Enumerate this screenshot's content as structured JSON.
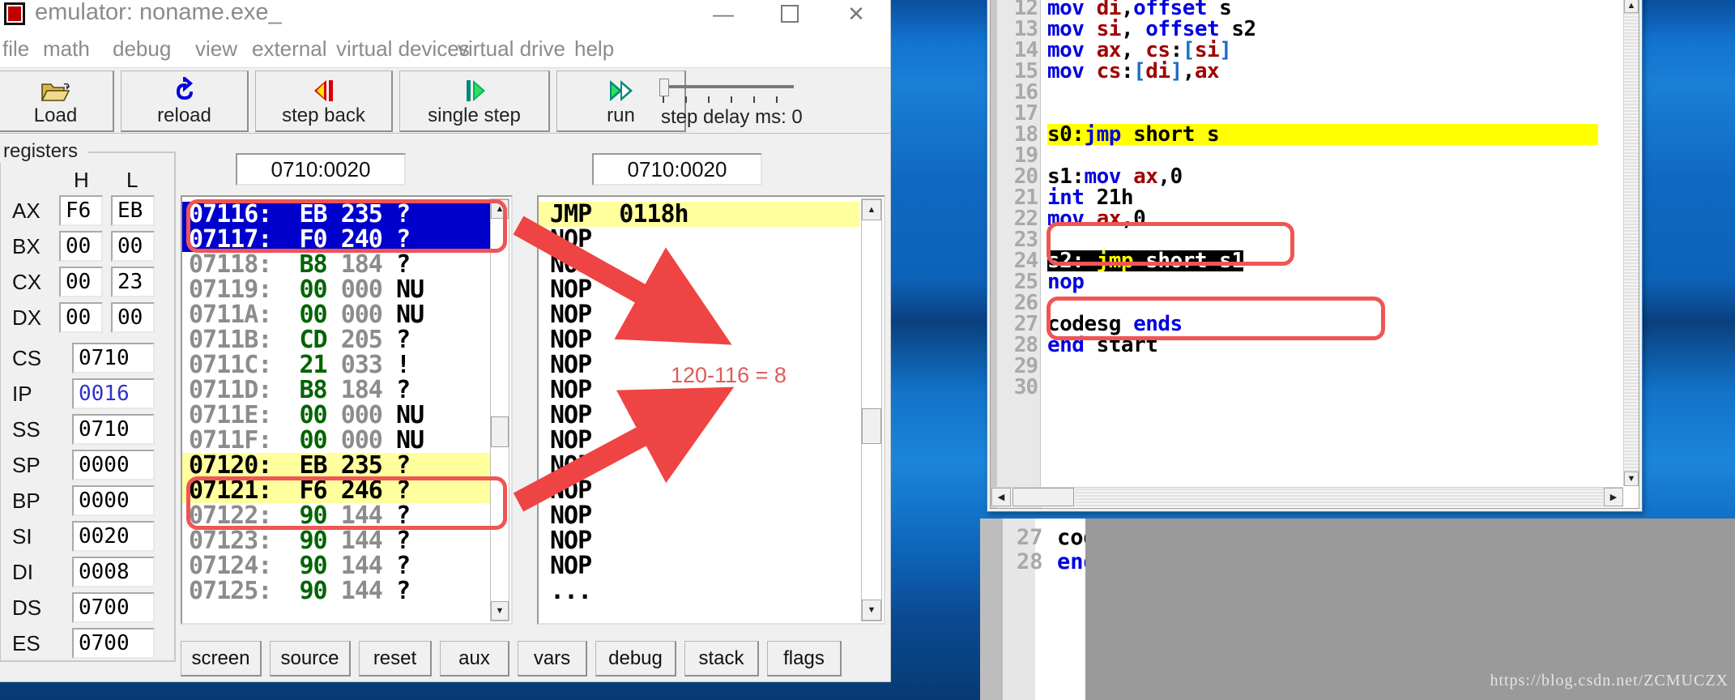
{
  "window": {
    "title": "emulator: noname.exe_",
    "icon": "chip-icon",
    "controls": {
      "minimize": "—",
      "maximize": "☐",
      "close": "✕"
    }
  },
  "menu": {
    "items": [
      "file",
      "math",
      "debug",
      "view",
      "external",
      "virtual devices",
      "virtual drive",
      "help"
    ]
  },
  "toolbar": {
    "buttons": [
      {
        "label": "Load",
        "icon": "open-folder-icon"
      },
      {
        "label": "reload",
        "icon": "reload-arrow-icon"
      },
      {
        "label": "step back",
        "icon": "step-back-icon"
      },
      {
        "label": "single step",
        "icon": "single-step-icon"
      },
      {
        "label": "run",
        "icon": "run-icon"
      }
    ],
    "delay_label": "step delay ms: 0",
    "delay_value": 0
  },
  "registers": {
    "legend": "registers",
    "col_headers": [
      "H",
      "L"
    ],
    "pairs": [
      {
        "name": "AX",
        "h": "F6",
        "l": "EB"
      },
      {
        "name": "BX",
        "h": "00",
        "l": "00"
      },
      {
        "name": "CX",
        "h": "00",
        "l": "23"
      },
      {
        "name": "DX",
        "h": "00",
        "l": "00"
      }
    ],
    "singles": [
      {
        "name": "CS",
        "value": "0710",
        "highlight": false
      },
      {
        "name": "IP",
        "value": "0016",
        "highlight": true
      },
      {
        "name": "SS",
        "value": "0710",
        "highlight": false
      },
      {
        "name": "SP",
        "value": "0000",
        "highlight": false
      },
      {
        "name": "BP",
        "value": "0000",
        "highlight": false
      },
      {
        "name": "SI",
        "value": "0020",
        "highlight": false
      },
      {
        "name": "DI",
        "value": "0008",
        "highlight": false
      },
      {
        "name": "DS",
        "value": "0700",
        "highlight": false
      },
      {
        "name": "ES",
        "value": "0700",
        "highlight": false
      }
    ]
  },
  "memory": {
    "address_field": "0710:0020",
    "rows": [
      {
        "addr": "07116:",
        "hex": "EB",
        "dec": "235",
        "chr": "?",
        "state": "selected"
      },
      {
        "addr": "07117:",
        "hex": "F0",
        "dec": "240",
        "chr": "?",
        "state": "selected"
      },
      {
        "addr": "07118:",
        "hex": "B8",
        "dec": "184",
        "chr": "?",
        "state": "normal"
      },
      {
        "addr": "07119:",
        "hex": "00",
        "dec": "000",
        "chr": "NU",
        "state": "normal"
      },
      {
        "addr": "0711A:",
        "hex": "00",
        "dec": "000",
        "chr": "NU",
        "state": "normal"
      },
      {
        "addr": "0711B:",
        "hex": "CD",
        "dec": "205",
        "chr": "?",
        "state": "normal"
      },
      {
        "addr": "0711C:",
        "hex": "21",
        "dec": "033",
        "chr": "!",
        "state": "normal"
      },
      {
        "addr": "0711D:",
        "hex": "B8",
        "dec": "184",
        "chr": "?",
        "state": "normal"
      },
      {
        "addr": "0711E:",
        "hex": "00",
        "dec": "000",
        "chr": "NU",
        "state": "normal"
      },
      {
        "addr": "0711F:",
        "hex": "00",
        "dec": "000",
        "chr": "NU",
        "state": "normal"
      },
      {
        "addr": "07120:",
        "hex": "EB",
        "dec": "235",
        "chr": "?",
        "state": "marked"
      },
      {
        "addr": "07121:",
        "hex": "F6",
        "dec": "246",
        "chr": "?",
        "state": "marked"
      },
      {
        "addr": "07122:",
        "hex": "90",
        "dec": "144",
        "chr": "?",
        "state": "normal"
      },
      {
        "addr": "07123:",
        "hex": "90",
        "dec": "144",
        "chr": "?",
        "state": "normal"
      },
      {
        "addr": "07124:",
        "hex": "90",
        "dec": "144",
        "chr": "?",
        "state": "normal"
      },
      {
        "addr": "07125:",
        "hex": "90",
        "dec": "144",
        "chr": "?",
        "state": "normal"
      }
    ]
  },
  "disassembly": {
    "address_field": "0710:0020",
    "rows": [
      {
        "text": "JMP  0118h",
        "highlight": true
      },
      {
        "text": "NOP",
        "highlight": false
      },
      {
        "text": "NOP",
        "highlight": false
      },
      {
        "text": "NOP",
        "highlight": false
      },
      {
        "text": "NOP",
        "highlight": false
      },
      {
        "text": "NOP",
        "highlight": false
      },
      {
        "text": "NOP",
        "highlight": false
      },
      {
        "text": "NOP",
        "highlight": false
      },
      {
        "text": "NOP",
        "highlight": false
      },
      {
        "text": "NOP",
        "highlight": false
      },
      {
        "text": "NOP",
        "highlight": false
      },
      {
        "text": "NOP",
        "highlight": false
      },
      {
        "text": "NOP",
        "highlight": false
      },
      {
        "text": "NOP",
        "highlight": false
      },
      {
        "text": "NOP",
        "highlight": false
      },
      {
        "text": "...",
        "highlight": false
      }
    ]
  },
  "bottom_buttons": [
    "screen",
    "source",
    "reset",
    "aux",
    "vars",
    "debug",
    "stack",
    "flags"
  ],
  "annotations": {
    "difference_note": "120-116 = 8"
  },
  "source_editor": {
    "lines": [
      {
        "num": "12",
        "tokens": [
          {
            "t": "mov ",
            "c": "kw"
          },
          {
            "t": "di",
            "c": "reg"
          },
          {
            "t": ",",
            "c": "plain"
          },
          {
            "t": "offset ",
            "c": "kw"
          },
          {
            "t": "s",
            "c": "plain"
          }
        ],
        "style": "none"
      },
      {
        "num": "13",
        "tokens": [
          {
            "t": "mov ",
            "c": "kw"
          },
          {
            "t": "si",
            "c": "reg"
          },
          {
            "t": ", ",
            "c": "plain"
          },
          {
            "t": "offset ",
            "c": "kw"
          },
          {
            "t": "s2",
            "c": "plain"
          }
        ],
        "style": "none"
      },
      {
        "num": "14",
        "tokens": [
          {
            "t": "mov ",
            "c": "kw"
          },
          {
            "t": "ax",
            "c": "reg"
          },
          {
            "t": ", ",
            "c": "plain"
          },
          {
            "t": "cs",
            "c": "reg"
          },
          {
            "t": ":",
            "c": "plain"
          },
          {
            "t": "[",
            "c": "brk"
          },
          {
            "t": "si",
            "c": "reg"
          },
          {
            "t": "]",
            "c": "brk"
          }
        ],
        "style": "none"
      },
      {
        "num": "15",
        "tokens": [
          {
            "t": "mov ",
            "c": "kw"
          },
          {
            "t": "cs",
            "c": "reg"
          },
          {
            "t": ":",
            "c": "plain"
          },
          {
            "t": "[",
            "c": "brk"
          },
          {
            "t": "di",
            "c": "reg"
          },
          {
            "t": "]",
            "c": "brk"
          },
          {
            "t": ",",
            "c": "plain"
          },
          {
            "t": "ax",
            "c": "reg"
          }
        ],
        "style": "none"
      },
      {
        "num": "16",
        "tokens": [],
        "style": "none"
      },
      {
        "num": "17",
        "tokens": [],
        "style": "none"
      },
      {
        "num": "18",
        "tokens": [
          {
            "t": "s0:",
            "c": "plain"
          },
          {
            "t": "jmp ",
            "c": "kw"
          },
          {
            "t": "short s",
            "c": "plain"
          }
        ],
        "style": "yellow"
      },
      {
        "num": "19",
        "tokens": [],
        "style": "none"
      },
      {
        "num": "20",
        "tokens": [
          {
            "t": "s1:",
            "c": "plain"
          },
          {
            "t": "mov ",
            "c": "kw"
          },
          {
            "t": "ax",
            "c": "reg"
          },
          {
            "t": ",0",
            "c": "plain"
          }
        ],
        "style": "none"
      },
      {
        "num": "21",
        "tokens": [
          {
            "t": "int ",
            "c": "kw"
          },
          {
            "t": "21h",
            "c": "plain"
          }
        ],
        "style": "none"
      },
      {
        "num": "22",
        "tokens": [
          {
            "t": "mov ",
            "c": "kw"
          },
          {
            "t": "ax",
            "c": "reg"
          },
          {
            "t": ",0",
            "c": "plain"
          }
        ],
        "style": "none"
      },
      {
        "num": "23",
        "tokens": [],
        "style": "none"
      },
      {
        "num": "24",
        "tokens": [
          {
            "t": "s2: ",
            "c": "plain"
          },
          {
            "t": "jmp",
            "c": "kwy"
          },
          {
            "t": " short s1",
            "c": "plain"
          }
        ],
        "style": "inverted"
      },
      {
        "num": "25",
        "tokens": [
          {
            "t": "nop",
            "c": "kw"
          }
        ],
        "style": "none"
      },
      {
        "num": "26",
        "tokens": [],
        "style": "none"
      },
      {
        "num": "27",
        "tokens": [
          {
            "t": "codesg ",
            "c": "plain"
          },
          {
            "t": "ends",
            "c": "kw"
          }
        ],
        "style": "none"
      },
      {
        "num": "28",
        "tokens": [
          {
            "t": "end ",
            "c": "kw"
          },
          {
            "t": "start",
            "c": "plain"
          }
        ],
        "style": "none"
      },
      {
        "num": "29",
        "tokens": [],
        "style": "none"
      },
      {
        "num": "30",
        "tokens": [],
        "style": "none"
      }
    ]
  },
  "background_editor": {
    "lines": [
      {
        "num": "27",
        "text": "codesg ends"
      },
      {
        "num": "28",
        "text": "end start"
      }
    ]
  },
  "watermark": "https://blog.csdn.net/ZCMUCZX",
  "colors": {
    "accent_red": "#ef5555",
    "annotation_text": "#e05a5a",
    "selection_blue": "#0000cc",
    "highlight_yellow": "#ffff9e",
    "source_highlight": "#ffff00",
    "hex_green": "#006400",
    "ip_blue": "#3030d0"
  }
}
